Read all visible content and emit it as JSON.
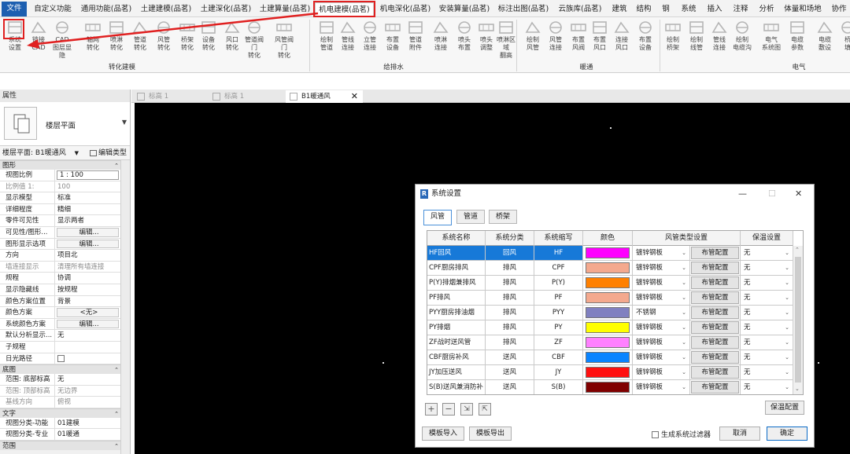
{
  "tabs": {
    "file": "文件",
    "items": [
      "自定义功能",
      "通用功能(品茗)",
      "土建建模(品茗)",
      "土建深化(品茗)",
      "土建算量(品茗)",
      "机电建模(品茗)",
      "机电深化(品茗)",
      "安装算量(品茗)",
      "标注出图(品茗)",
      "云族库(品茗)",
      "建筑",
      "结构",
      "钢",
      "系统",
      "插入",
      "注释",
      "分析",
      "体量和场地",
      "协作"
    ],
    "active_index": 5
  },
  "ribbon": {
    "buttons": [
      {
        "l1": "系统",
        "l2": "设置",
        "icon": "settings-icon"
      },
      {
        "l1": "链接",
        "l2": "CAD",
        "icon": "cad-link-icon"
      },
      {
        "l1": "CAD",
        "l2": "图层显隐",
        "icon": "cad-layer-icon"
      },
      {
        "l1": "轴网",
        "l2": "转化",
        "icon": "grid-icon"
      },
      {
        "l1": "喷淋",
        "l2": "转化",
        "icon": "sprinkler-icon"
      },
      {
        "l1": "管道",
        "l2": "转化",
        "icon": "pipe-icon"
      },
      {
        "l1": "风管",
        "l2": "转化",
        "icon": "duct-icon"
      },
      {
        "l1": "桥架",
        "l2": "转化",
        "icon": "tray-icon"
      },
      {
        "l1": "设备",
        "l2": "转化",
        "icon": "equipment-icon"
      },
      {
        "l1": "风口",
        "l2": "转化",
        "icon": "air-terminal-icon"
      },
      {
        "l1": "管道阀门",
        "l2": "转化",
        "icon": "pipe-valve-icon"
      },
      {
        "l1": "风管阀门",
        "l2": "转化",
        "icon": "duct-valve-icon"
      },
      {
        "l1": "绘制",
        "l2": "管道",
        "icon": "draw-pipe-icon"
      },
      {
        "l1": "管线",
        "l2": "连接",
        "icon": "pipe-connect-icon"
      },
      {
        "l1": "立管",
        "l2": "连接",
        "icon": "riser-icon"
      },
      {
        "l1": "布置",
        "l2": "设备",
        "icon": "place-equip-icon"
      },
      {
        "l1": "管道",
        "l2": "附件",
        "icon": "pipe-fitting-icon"
      },
      {
        "l1": "喷淋",
        "l2": "连接",
        "icon": "sprinkler-connect-icon"
      },
      {
        "l1": "喷头",
        "l2": "布置",
        "icon": "sprinkler-head-icon"
      },
      {
        "l1": "喷头",
        "l2": "调整",
        "icon": "sprinkler-adjust-icon"
      },
      {
        "l1": "喷淋区域",
        "l2": "翻高",
        "icon": "sprinkler-area-icon"
      },
      {
        "l1": "绘制",
        "l2": "风管",
        "icon": "draw-duct-icon"
      },
      {
        "l1": "风管",
        "l2": "连接",
        "icon": "duct-connect-icon"
      },
      {
        "l1": "布置",
        "l2": "风阀",
        "icon": "place-damper-icon"
      },
      {
        "l1": "布置",
        "l2": "风口",
        "icon": "place-vent-icon"
      },
      {
        "l1": "连接",
        "l2": "风口",
        "icon": "connect-vent-icon"
      },
      {
        "l1": "布置",
        "l2": "设备",
        "icon": "place-hvac-icon"
      },
      {
        "l1": "绘制",
        "l2": "桥架",
        "icon": "draw-tray-icon"
      },
      {
        "l1": "绘制",
        "l2": "线管",
        "icon": "draw-conduit-icon"
      },
      {
        "l1": "管线",
        "l2": "连接",
        "icon": "conduit-connect-icon"
      },
      {
        "l1": "绘制",
        "l2": "电缆沟",
        "icon": "cable-trench-icon"
      },
      {
        "l1": "电气",
        "l2": "系统图",
        "icon": "elec-system-icon"
      },
      {
        "l1": "电缆",
        "l2": "参数",
        "icon": "cable-param-icon"
      },
      {
        "l1": "电缆",
        "l2": "敷设",
        "icon": "cable-lay-icon"
      },
      {
        "l1": "桥",
        "l2": "填",
        "icon": "tray-fill-icon"
      }
    ],
    "groups": [
      "转化建模",
      "给排水",
      "暖通",
      "电气"
    ]
  },
  "properties": {
    "title": "属性",
    "type_name": "楼层平面",
    "selector": "楼层平面: B1暖通风",
    "edit_type": "编辑类型",
    "group_graphics": "图形",
    "rows": [
      {
        "k": "视图比例",
        "v": "1 : 100",
        "style": "input"
      },
      {
        "k": "比例值 1:",
        "v": "100",
        "style": "grey"
      },
      {
        "k": "显示模型",
        "v": "标准"
      },
      {
        "k": "详细程度",
        "v": "精细"
      },
      {
        "k": "零件可见性",
        "v": "显示两者"
      },
      {
        "k": "可见性/图形...",
        "v": "编辑...",
        "style": "btn"
      },
      {
        "k": "图形显示选项",
        "v": "编辑...",
        "style": "btn"
      },
      {
        "k": "方向",
        "v": "项目北"
      },
      {
        "k": "墙连接显示",
        "v": "清理所有墙连接",
        "style": "grey"
      },
      {
        "k": "规程",
        "v": "协调"
      },
      {
        "k": "显示隐藏线",
        "v": "按规程"
      },
      {
        "k": "颜色方案位置",
        "v": "背景"
      },
      {
        "k": "颜色方案",
        "v": "<无>",
        "style": "btn"
      },
      {
        "k": "系统颜色方案",
        "v": "编辑...",
        "style": "btn"
      },
      {
        "k": "默认分析显示...",
        "v": "无"
      },
      {
        "k": "子规程",
        "v": ""
      },
      {
        "k": "日光路径",
        "v": "",
        "style": "check"
      }
    ],
    "group_underlay": "底图",
    "underlay_rows": [
      {
        "k": "范围: 底部标高",
        "v": "无"
      },
      {
        "k": "范围: 顶部标高",
        "v": "无边界",
        "style": "grey"
      },
      {
        "k": "基线方向",
        "v": "俯视",
        "style": "grey"
      }
    ],
    "group_text": "文字",
    "text_rows": [
      {
        "k": "视图分类-功能",
        "v": "01建模"
      },
      {
        "k": "视图分类-专业",
        "v": "01暖通"
      }
    ],
    "group_extent": "范围"
  },
  "view_tabs": [
    {
      "label": "标高 1",
      "active": false
    },
    {
      "label": "标高 1",
      "active": false
    },
    {
      "label": "B1暖通风",
      "active": true
    }
  ],
  "dialog": {
    "title": "系统设置",
    "tabs": [
      "风管",
      "管道",
      "桥架"
    ],
    "active_tab": 0,
    "headers": [
      "系统名称",
      "系统分类",
      "系统缩写",
      "颜色",
      "风管类型设置",
      "保温设置"
    ],
    "rows": [
      {
        "name": "HF回风",
        "cls": "回风",
        "abbr": "HF",
        "color": "#ff00ff",
        "duct": "镀锌钢板",
        "btn": "布管配置",
        "ins": "无"
      },
      {
        "name": "CPF厨房排风",
        "cls": "排风",
        "abbr": "CPF",
        "color": "#f4a98e",
        "duct": "镀锌钢板",
        "btn": "布管配置",
        "ins": "无"
      },
      {
        "name": "P(Y)排烟兼排风",
        "cls": "排风",
        "abbr": "P(Y)",
        "color": "#ff8000",
        "duct": "镀锌钢板",
        "btn": "布管配置",
        "ins": "无"
      },
      {
        "name": "PF排风",
        "cls": "排风",
        "abbr": "PF",
        "color": "#f4a98e",
        "duct": "镀锌钢板",
        "btn": "布管配置",
        "ins": "无"
      },
      {
        "name": "PYY厨房排油烟",
        "cls": "排风",
        "abbr": "PYY",
        "color": "#8080c0",
        "duct": "不锈钢",
        "btn": "布管配置",
        "ins": "无"
      },
      {
        "name": "PY排烟",
        "cls": "排风",
        "abbr": "PY",
        "color": "#ffff00",
        "duct": "镀锌钢板",
        "btn": "布管配置",
        "ins": "无"
      },
      {
        "name": "ZF战时送风管",
        "cls": "排风",
        "abbr": "ZF",
        "color": "#ff80ff",
        "duct": "镀锌钢板",
        "btn": "布管配置",
        "ins": "无"
      },
      {
        "name": "CBF厨房补风",
        "cls": "送风",
        "abbr": "CBF",
        "color": "#0a84ff",
        "duct": "镀锌钢板",
        "btn": "布管配置",
        "ins": "无"
      },
      {
        "name": "JY加压送风",
        "cls": "送风",
        "abbr": "JY",
        "color": "#ff1010",
        "duct": "镀锌钢板",
        "btn": "布管配置",
        "ins": "无"
      },
      {
        "name": "S(B)送风兼消防补",
        "cls": "送风",
        "abbr": "S(B)",
        "color": "#800000",
        "duct": "镀锌钢板",
        "btn": "布管配置",
        "ins": "无"
      }
    ],
    "insulation_config": "保温配置",
    "import_label": "模板导入",
    "export_label": "模板导出",
    "filter_label": "生成系统过滤器",
    "cancel_label": "取消",
    "ok_label": "确定"
  }
}
